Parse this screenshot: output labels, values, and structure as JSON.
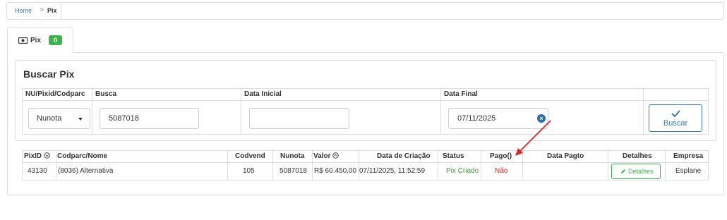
{
  "breadcrumb": {
    "home": "Home",
    "separator": ">",
    "current": "Pix"
  },
  "tab": {
    "label": "Pix",
    "badge": "0",
    "icon": "money-icon"
  },
  "search": {
    "title": "Buscar Pix",
    "headers": [
      "NU/Pixid/Codparc",
      "Busca",
      "Data Inicial",
      "Data Final"
    ],
    "type_select": {
      "value": "Nunota"
    },
    "busca_value": "5087018",
    "data_inicial_value": "",
    "data_final_value": "07/11/2025",
    "clear_label": "×",
    "button_label": "Buscar",
    "button_icon": "check-icon"
  },
  "results": {
    "headers": {
      "pixid": "PixID",
      "codparc": "Codparc/Nome",
      "codvend": "Codvend",
      "nunota": "Nunota",
      "valor": "Valor",
      "data_criacao": "Data de Criação",
      "status": "Status",
      "pago": "Pago()",
      "data_pagto": "Data Pagto",
      "detalhes": "Detalhes",
      "empresa": "Empresa"
    },
    "sort_icon": "sort-circle-icon",
    "row": {
      "pixid": "43130",
      "codparc": "(8036) Alternativa",
      "codvend": "105",
      "nunota": "5087018",
      "valor": "R$ 60.450,00",
      "data_criacao": "07/11/2025, 11:52:59",
      "status": "Pix Criado",
      "pago": "Não",
      "data_pagto": "",
      "detalhes_label": "Detalhes",
      "empresa": "Esplane"
    }
  },
  "colors": {
    "link": "#3a7bbf",
    "success": "#3bb54a",
    "danger": "#e02424",
    "arrow": "#e02424"
  }
}
